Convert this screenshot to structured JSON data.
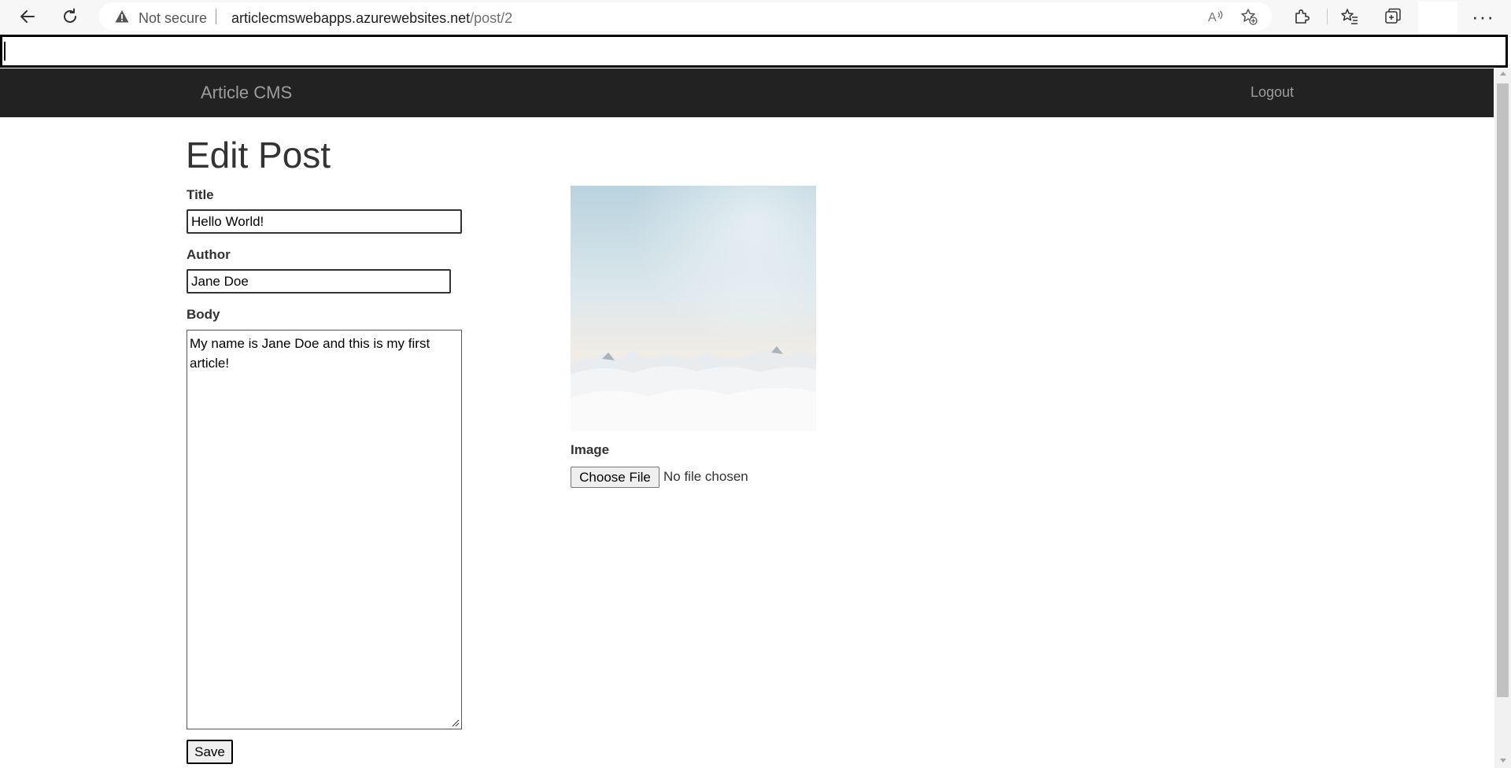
{
  "browser": {
    "security_label": "Not secure",
    "url_host": "articlecmswebapps.azurewebsites.net",
    "url_path": "/post/2"
  },
  "site": {
    "brand": "Article CMS",
    "logout_label": "Logout"
  },
  "form": {
    "heading": "Edit Post",
    "title_label": "Title",
    "title_value": "Hello World!",
    "author_label": "Author",
    "author_value": "Jane Doe",
    "body_label": "Body",
    "body_value": "My name is Jane Doe and this is my first article!",
    "save_label": "Save",
    "image_label": "Image",
    "choose_file_label": "Choose File",
    "file_status": "No file chosen"
  },
  "colors": {
    "navbar_bg": "#222222",
    "navbar_text": "#9d9d9d",
    "text": "#333333"
  }
}
